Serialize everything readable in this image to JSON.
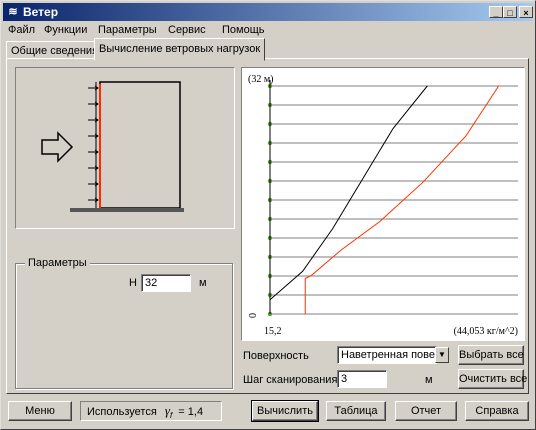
{
  "window": {
    "title": "Ветер"
  },
  "menu": [
    "Файл",
    "Функции",
    "Параметры",
    "Сервис",
    "Помощь"
  ],
  "tabs": [
    {
      "label": "Общие сведения",
      "active": false
    },
    {
      "label": "Вычисление ветровых нагрузок",
      "active": true
    }
  ],
  "parameters": {
    "group_label": "Параметры",
    "h_label": "H",
    "h_value": "32",
    "h_unit": "м"
  },
  "chart": {
    "top_label": "(32 м)",
    "bottom_label": "0",
    "x_left_label": "15,2",
    "x_right_label": "(44,053 кг/м^2)"
  },
  "chart_data": {
    "type": "line",
    "title": "",
    "xlabel": "",
    "ylabel": "",
    "ylim": [
      0,
      32
    ],
    "xlim": [
      15.2,
      44.053
    ],
    "grid": true,
    "series": [
      {
        "color": "#000000",
        "x": [
          15.2,
          19.0,
          22.5,
          26.0,
          29.5,
          33.5
        ],
        "y": [
          2,
          6,
          12,
          19,
          26,
          32
        ]
      },
      {
        "color": "#ff3300",
        "x": [
          19.3,
          19.3,
          20.0,
          23.5,
          28.0,
          33.0,
          38.0,
          41.8
        ],
        "y": [
          0,
          5,
          5.4,
          9,
          13,
          18.5,
          25,
          32
        ]
      }
    ]
  },
  "surface": {
    "label": "Поверхность",
    "value": "Наветренная поверхн"
  },
  "scan_step": {
    "label": "Шаг сканирования",
    "value": "3",
    "unit": "м"
  },
  "buttons": {
    "select_all": "Выбрать все",
    "clear_all": "Очистить все",
    "menu": "Меню",
    "calculate": "Вычислить",
    "table": "Таблица",
    "report": "Отчет",
    "help": "Справка"
  },
  "status": {
    "prefix": "Используется",
    "symbol": "γ",
    "subscript": "f",
    "suffix": "= 1,4"
  }
}
